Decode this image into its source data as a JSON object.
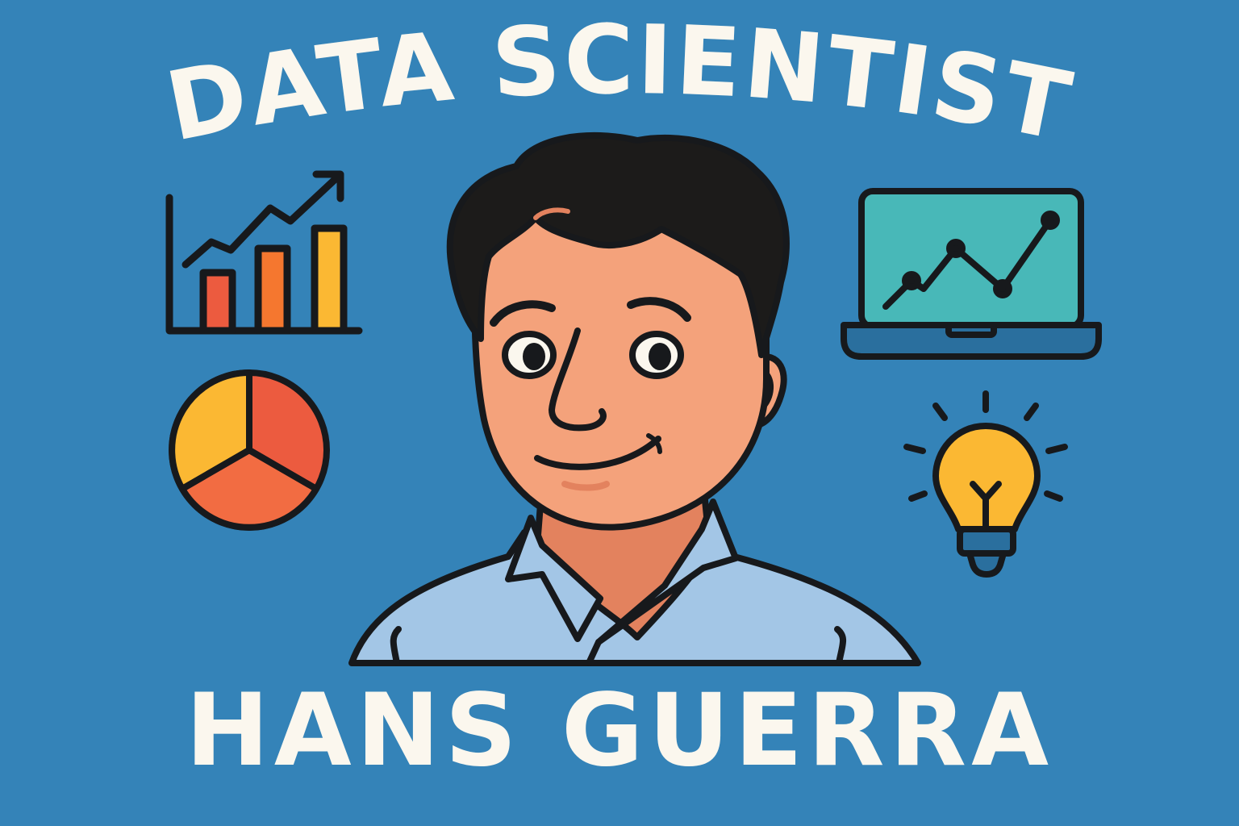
{
  "title": "DATA SCIENTIST",
  "name": "HANS GUERRA",
  "colors": {
    "background": "#3483b8",
    "text": "#fbf7ee",
    "outline": "#17191c",
    "skin": "#f4a27b",
    "skin_shadow": "#e3825e",
    "hair": "#1c1b1a",
    "shirt": "#a3c6e6",
    "bar_red": "#ec5b3f",
    "bar_orange": "#f5772f",
    "bar_yellow": "#fbb833",
    "pie_yellow": "#fbb833",
    "pie_red": "#ec5b3f",
    "pie_orange": "#f26c42",
    "screen": "#48b8b8",
    "laptop_base": "#2a6f9e",
    "bulb": "#fbb833",
    "bulb_base": "#2a6f9e"
  },
  "icons": {
    "bar_chart": "bar-chart-trend-icon",
    "pie_chart": "pie-chart-icon",
    "laptop": "laptop-line-chart-icon",
    "lightbulb": "lightbulb-idea-icon"
  }
}
